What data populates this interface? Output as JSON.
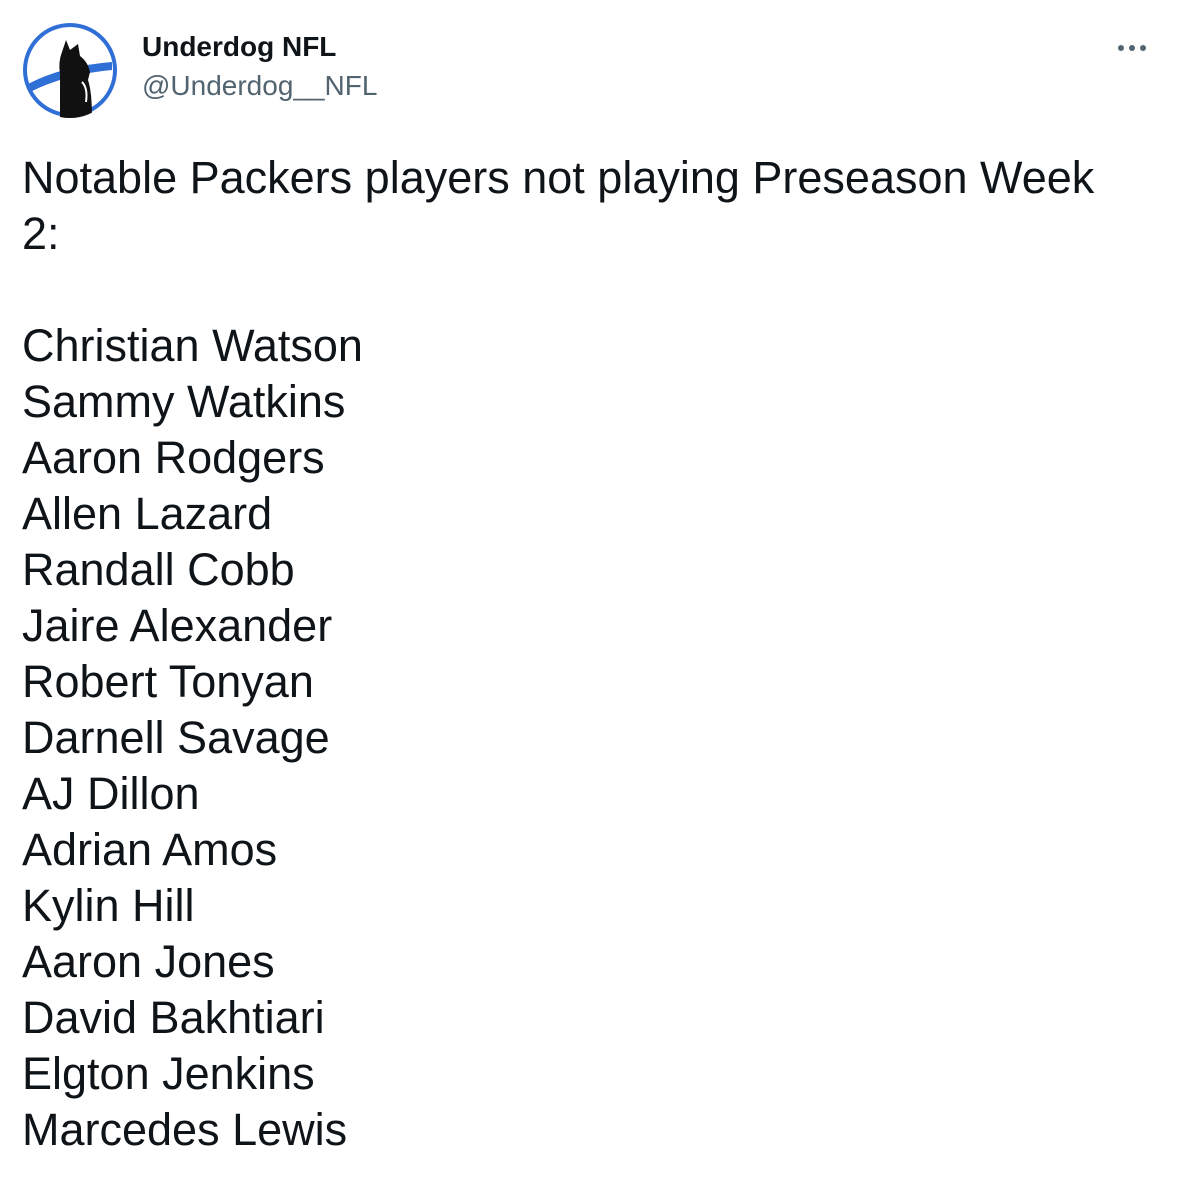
{
  "author": {
    "display_name": "Underdog NFL",
    "handle": "@Underdog__NFL",
    "avatar_icon": "underdog-dog-logo-icon",
    "accent_color": "#2f6fd6"
  },
  "menu": {
    "icon": "more-horizontal-icon"
  },
  "tweet": {
    "intro": "Notable Packers players not playing Preseason Week 2:",
    "players": [
      "Christian Watson",
      "Sammy Watkins",
      "Aaron Rodgers",
      "Allen Lazard",
      "Randall Cobb",
      "Jaire Alexander",
      "Robert Tonyan",
      "Darnell Savage",
      "AJ Dillon",
      "Adrian Amos",
      "Kylin Hill",
      "Aaron Jones",
      "David Bakhtiari",
      "Elgton Jenkins",
      "Marcedes Lewis"
    ]
  }
}
